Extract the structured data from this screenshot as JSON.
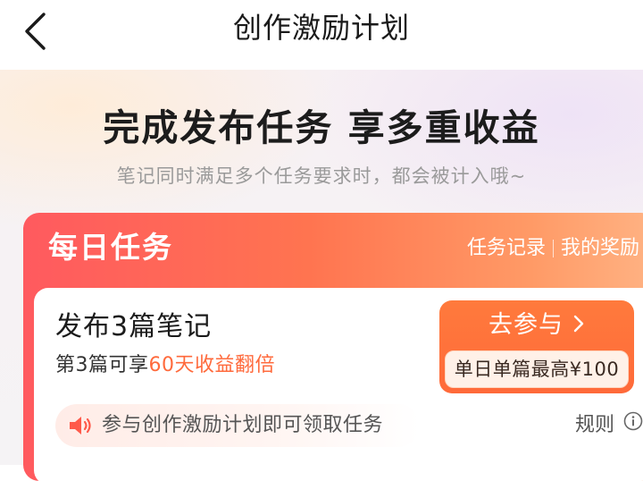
{
  "navbar": {
    "title": "创作激励计划",
    "back_icon": "chevron-left-icon"
  },
  "hero": {
    "title": "完成发布任务 享多重收益",
    "subtitle": "笔记同时满足多个任务要求时，都会被计入哦~"
  },
  "daily_tasks": {
    "title": "每日任务",
    "links": [
      "任务记录",
      "我的奖励"
    ],
    "task": {
      "name": "发布3篇笔记",
      "desc_prefix": "第3篇可享",
      "desc_highlight": "60天收益翻倍",
      "join_label": "去参与",
      "reward": "单日单篇最高¥100"
    },
    "notice": "参与创作激励计划即可领取任务",
    "rules_label": "规则"
  },
  "colors": {
    "accent": "#ff6a3c",
    "card_gradient_start": "#ff5a5f",
    "card_gradient_end": "#ffb384",
    "join_button": "#ff7a3c",
    "speaker": "#ff5a4a"
  },
  "icons": {
    "back": "chevron-left-icon",
    "join_arrow": "chevron-right-icon",
    "notice": "speaker-icon",
    "rules": "info-icon"
  }
}
